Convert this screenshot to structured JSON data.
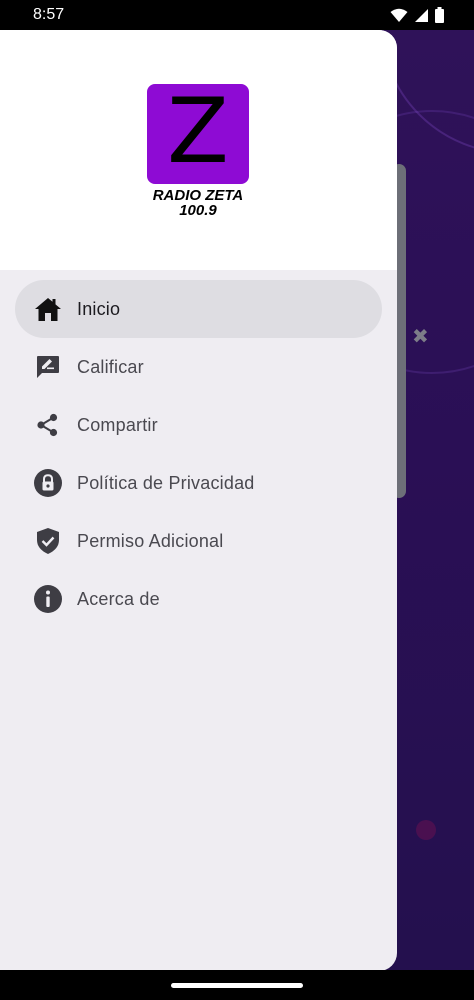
{
  "status": {
    "time": "8:57"
  },
  "logo": {
    "letter": "Z",
    "name": "RADIO ZETA",
    "frequency": "100.9",
    "brand_color": "#8e0bd4"
  },
  "menu": {
    "items": [
      {
        "label": "Inicio",
        "icon": "home-icon",
        "active": true
      },
      {
        "label": "Calificar",
        "icon": "rate-review-icon",
        "active": false
      },
      {
        "label": "Compartir",
        "icon": "share-icon",
        "active": false
      },
      {
        "label": "Política de Privacidad",
        "icon": "lock-icon",
        "active": false
      },
      {
        "label": "Permiso Adicional",
        "icon": "shield-check-icon",
        "active": false
      },
      {
        "label": "Acerca de",
        "icon": "info-icon",
        "active": false
      }
    ]
  },
  "colors": {
    "drawer_bg": "#efedf2",
    "active_item_bg": "#dedde2",
    "app_bg": "#2a0f55"
  }
}
